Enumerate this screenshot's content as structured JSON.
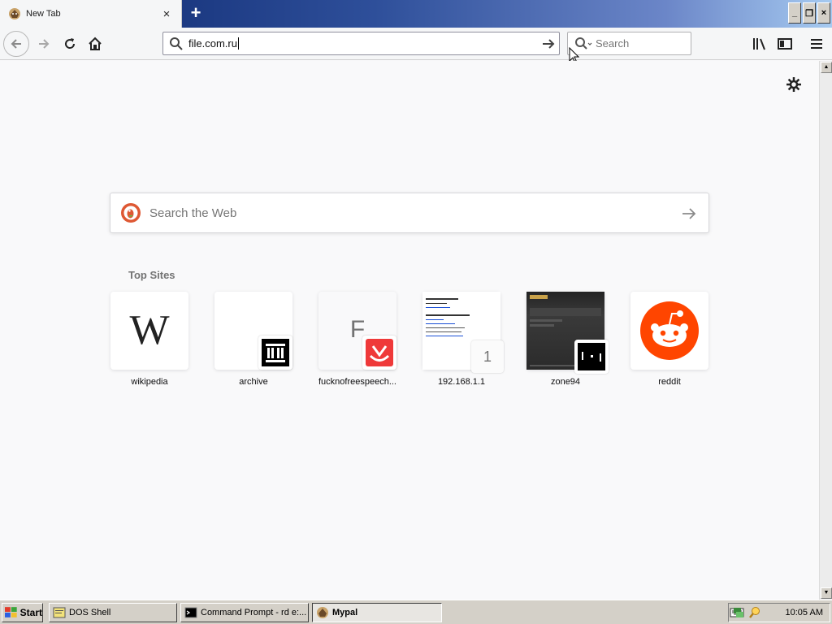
{
  "browser": {
    "tab": {
      "title": "New Tab",
      "close": "×"
    },
    "new_tab": "+",
    "window_controls": {
      "minimize": "_",
      "restore": "❐",
      "close": "×"
    },
    "url": "file.com.ru",
    "search_placeholder": "Search"
  },
  "newtab": {
    "search_placeholder": "Search the Web",
    "top_sites_title": "Top Sites",
    "sites": [
      {
        "label": "wikipedia",
        "icon": "wikipedia-logo"
      },
      {
        "label": "archive",
        "icon": "archive-logo"
      },
      {
        "label": "fucknofreespeech...",
        "tile_letter": "F",
        "icon": "vivaldi-logo"
      },
      {
        "label": "192.168.1.1",
        "badge": "1",
        "icon": "page-screenshot"
      },
      {
        "label": "zone94",
        "icon": "pong-logo"
      },
      {
        "label": "reddit",
        "icon": "reddit-logo"
      }
    ]
  },
  "taskbar": {
    "start_label": "Start",
    "tasks": [
      {
        "label": "DOS Shell",
        "icon": "dos-shell-icon"
      },
      {
        "label": "Command Prompt - rd e:...",
        "icon": "cmd-icon"
      },
      {
        "label": "Mypal",
        "icon": "mypal-icon",
        "active": true
      }
    ],
    "clock": "10:05 AM"
  },
  "colors": {
    "reddit": "#ff4500",
    "vivaldi": "#ef3939",
    "titlebar_start": "#0a246a",
    "titlebar_end": "#a6caf0"
  }
}
